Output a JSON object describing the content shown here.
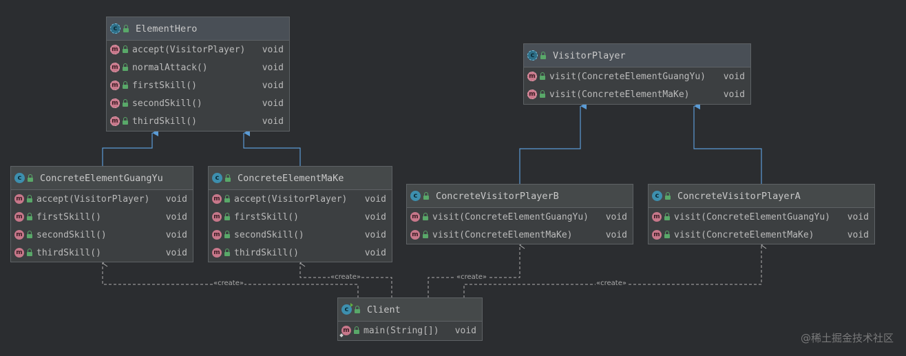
{
  "classes": {
    "element_hero": {
      "name": "ElementHero",
      "kind": "abstract-class",
      "methods": [
        {
          "sig": "accept(VisitorPlayer)",
          "ret": "void"
        },
        {
          "sig": "normalAttack()",
          "ret": "void"
        },
        {
          "sig": "firstSkill()",
          "ret": "void"
        },
        {
          "sig": "secondSkill()",
          "ret": "void"
        },
        {
          "sig": "thirdSkill()",
          "ret": "void"
        }
      ]
    },
    "concrete_element_guangyu": {
      "name": "ConcreteElementGuangYu",
      "kind": "class",
      "methods": [
        {
          "sig": "accept(VisitorPlayer)",
          "ret": "void"
        },
        {
          "sig": "firstSkill()",
          "ret": "void"
        },
        {
          "sig": "secondSkill()",
          "ret": "void"
        },
        {
          "sig": "thirdSkill()",
          "ret": "void"
        }
      ]
    },
    "concrete_element_make": {
      "name": "ConcreteElementMaKe",
      "kind": "class",
      "methods": [
        {
          "sig": "accept(VisitorPlayer)",
          "ret": "void"
        },
        {
          "sig": "firstSkill()",
          "ret": "void"
        },
        {
          "sig": "secondSkill()",
          "ret": "void"
        },
        {
          "sig": "thirdSkill()",
          "ret": "void"
        }
      ]
    },
    "visitor_player": {
      "name": "VisitorPlayer",
      "kind": "abstract-class",
      "methods": [
        {
          "sig": "visit(ConcreteElementGuangYu)",
          "ret": "void"
        },
        {
          "sig": "visit(ConcreteElementMaKe)",
          "ret": "void"
        }
      ]
    },
    "concrete_visitor_player_b": {
      "name": "ConcreteVisitorPlayerB",
      "kind": "class",
      "methods": [
        {
          "sig": "visit(ConcreteElementGuangYu)",
          "ret": "void"
        },
        {
          "sig": "visit(ConcreteElementMaKe)",
          "ret": "void"
        }
      ]
    },
    "concrete_visitor_player_a": {
      "name": "ConcreteVisitorPlayerA",
      "kind": "class",
      "methods": [
        {
          "sig": "visit(ConcreteElementGuangYu)",
          "ret": "void"
        },
        {
          "sig": "visit(ConcreteElementMaKe)",
          "ret": "void"
        }
      ]
    },
    "client": {
      "name": "Client",
      "kind": "runnable-class",
      "methods": [
        {
          "sig": "main(String[])",
          "ret": "void"
        }
      ]
    }
  },
  "icons": {
    "class_letter": "c",
    "method_letter": "m"
  },
  "relations": {
    "create_label": "«create»"
  },
  "colors": {
    "background": "#2b2d30",
    "inheritance_arrow": "#5b9bd5",
    "dependency_line": "#b0b0b0"
  },
  "watermark": "@稀土掘金技术社区"
}
